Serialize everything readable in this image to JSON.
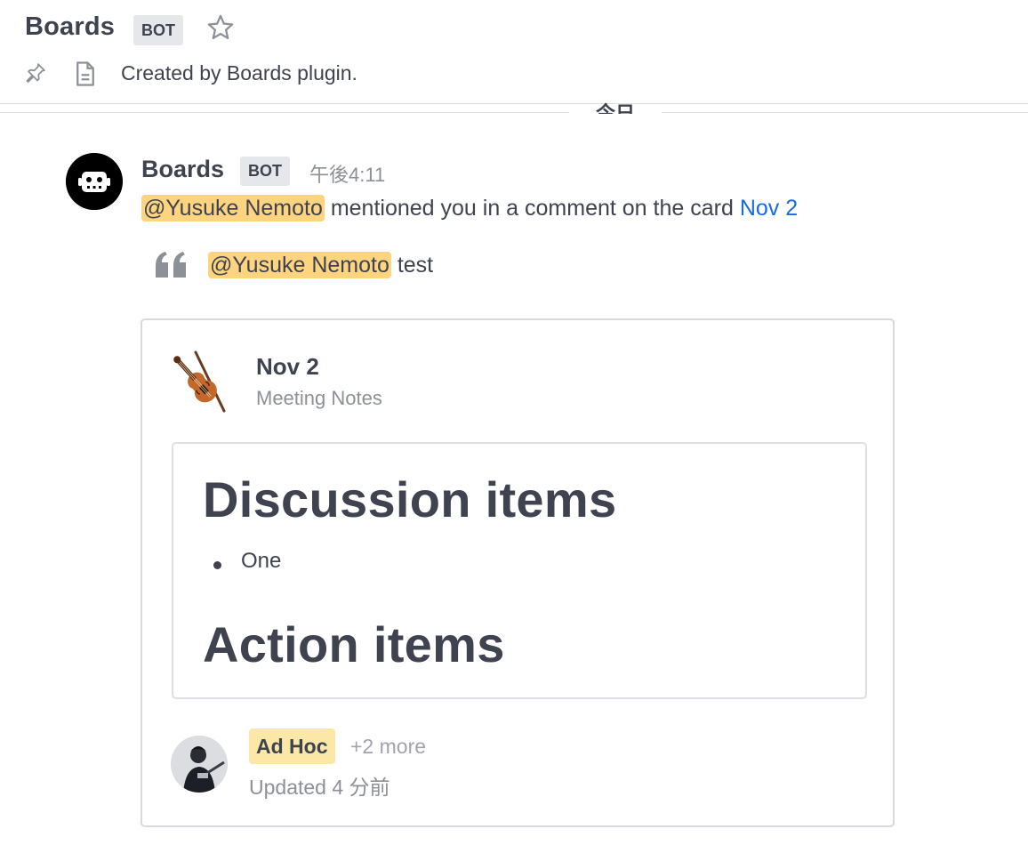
{
  "header": {
    "title": "Boards",
    "badge": "BOT",
    "description": "Created by Boards plugin."
  },
  "date_separator": "今日",
  "post": {
    "author": "Boards",
    "badge": "BOT",
    "time": "午後4:11",
    "mention": "@Yusuke Nemoto",
    "message_text": " mentioned you in a comment on the card ",
    "card_link": "Nov 2",
    "quote": {
      "mention": "@Yusuke Nemoto",
      "text": " test"
    }
  },
  "card": {
    "title": "Nov 2",
    "subtitle": "Meeting Notes",
    "heading_1": "Discussion items",
    "bullet_1": "One",
    "heading_2": "Action items",
    "tag": "Ad Hoc",
    "more": "+2 more",
    "updated": "Updated 4 分前"
  },
  "colors": {
    "mention_highlight": "#ffd47f",
    "link": "#166de0",
    "tag_bg": "#fbe7a6",
    "badge_bg": "#e6e7ea"
  }
}
